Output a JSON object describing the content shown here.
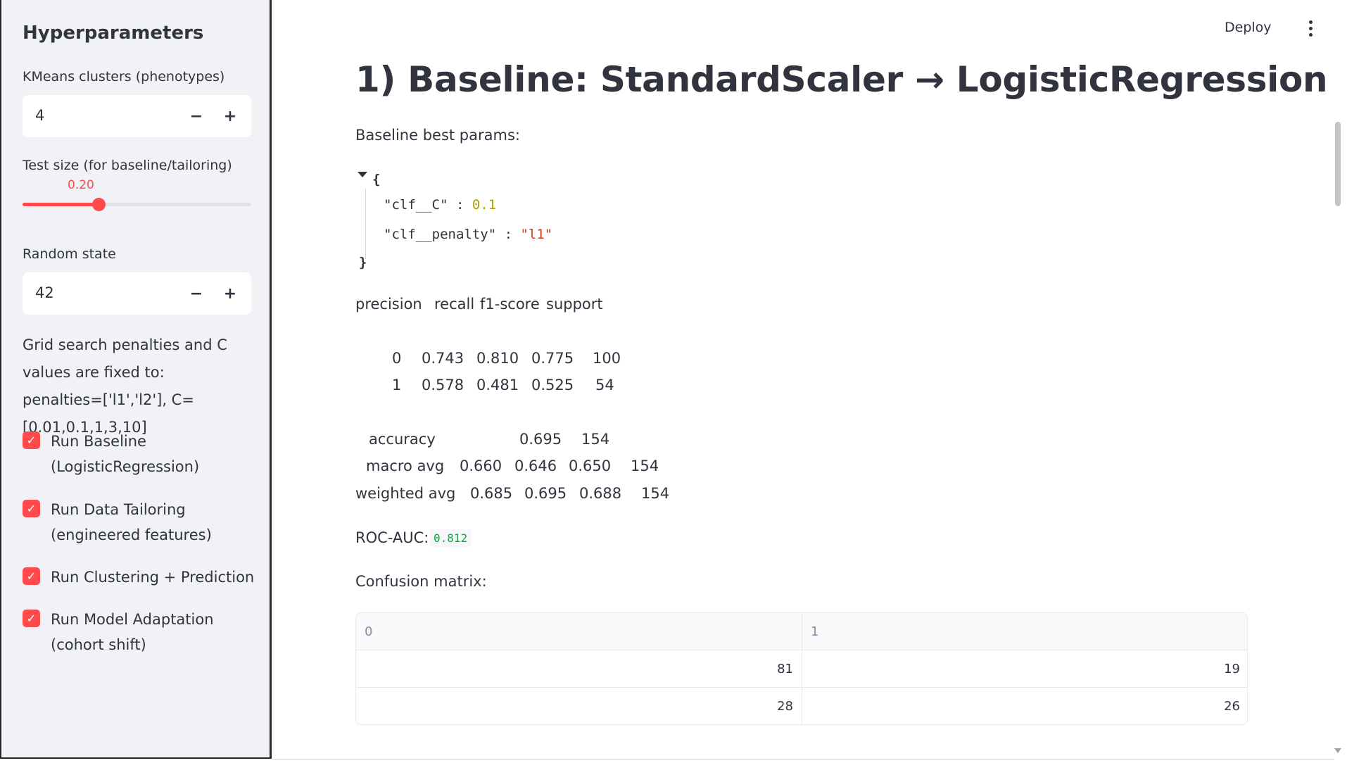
{
  "sidebar": {
    "title": "Hyperparameters",
    "kmeans": {
      "label": "KMeans clusters (phenotypes)",
      "value": "4",
      "minus": "−",
      "plus": "+"
    },
    "test_size": {
      "label": "Test size (for baseline/tailoring)",
      "value": "0.20",
      "fraction": 0.2
    },
    "random_state": {
      "label": "Random state",
      "value": "42",
      "minus": "−",
      "plus": "+"
    },
    "grid_note": "Grid search penalties and C values are fixed to: penalties=['l1','l2'], C=[0.01,0.1,1,3,10]",
    "checkboxes": [
      {
        "label": "Run Baseline (LogisticRegression)",
        "checked": true
      },
      {
        "label": "Run Data Tailoring (engineered features)",
        "checked": true
      },
      {
        "label": "Run Clustering + Prediction",
        "checked": true
      },
      {
        "label": "Run Model Adaptation (cohort shift)",
        "checked": true
      }
    ],
    "checkmark": "✓"
  },
  "header": {
    "deploy_label": "Deploy",
    "menu_icon": "kebab-menu-icon"
  },
  "main": {
    "title": "1) Baseline: StandardScaler → LogisticRegression",
    "best_params_label": "Baseline best params:",
    "json": {
      "open_brace": "{",
      "close_brace": "}",
      "entries": [
        {
          "key": "\"clf__C\"",
          "sep": " : ",
          "value": "0.1",
          "type": "number"
        },
        {
          "key": "\"clf__penalty\"",
          "sep": " : ",
          "value": "\"l1\"",
          "type": "string"
        }
      ]
    },
    "report": {
      "header": [
        "precision",
        "recall",
        "f1-score",
        "support"
      ],
      "rows": [
        {
          "label": "0",
          "values": [
            "0.743",
            "0.810",
            "0.775",
            "100"
          ]
        },
        {
          "label": "1",
          "values": [
            "0.578",
            "0.481",
            "0.525",
            "54"
          ]
        }
      ],
      "accuracy": {
        "label": "accuracy",
        "values": [
          "0.695",
          "154"
        ]
      },
      "macro_avg": {
        "label": "macro avg",
        "values": [
          "0.660",
          "0.646",
          "0.650",
          "154"
        ]
      },
      "weighted_avg": {
        "label": "weighted avg",
        "values": [
          "0.685",
          "0.695",
          "0.688",
          "154"
        ]
      }
    },
    "roc_auc_label": "ROC-AUC:",
    "roc_auc_value": "0.812",
    "confusion_label": "Confusion matrix:",
    "confusion_matrix": {
      "columns": [
        "0",
        "1"
      ],
      "rows": [
        [
          "81",
          "19"
        ],
        [
          "28",
          "26"
        ]
      ]
    }
  },
  "colors": {
    "accent": "#ff4b4b",
    "sidebar_bg": "#f0f2f6",
    "text": "#31333f",
    "json_number": "#aaa100",
    "json_string": "#cc3d1c",
    "code_green": "#09ab3b"
  }
}
